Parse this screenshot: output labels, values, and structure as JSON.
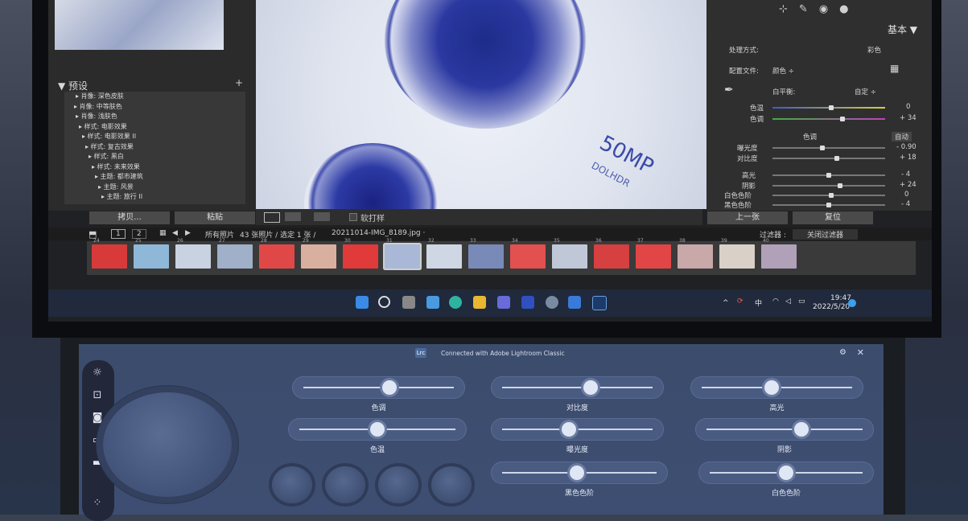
{
  "lightroom": {
    "left_panel": {
      "preset_header": "▼ 预设",
      "add_icon": "plus-icon",
      "presets": [
        "▸ 肖像: 深色皮肤",
        "▸ 肖像: 中等肤色",
        "▸ 肖像: 浅肤色",
        "▸ 样式: 电影效果",
        "▸ 样式: 电影效果 II",
        "▸ 样式: 复古效果",
        "▸ 样式: 黑白",
        "▸ 样式: 未来效果",
        "▸ 主题: 都市建筑",
        "▸ 主题: 风景",
        "▸ 主题: 旅行 II"
      ],
      "copy_button": "拷贝...",
      "paste_button": "粘贴"
    },
    "photo": {
      "mp_text": "50MP",
      "mp_sub": "DOLHDR"
    },
    "toolbar": {
      "softproof_label": "软打样"
    },
    "right_panel": {
      "title": "基本 ▼",
      "treatment_label": "处理方式:",
      "treatment_value": "彩色",
      "profile_label": "配置文件:",
      "profile_value": "颜色 ÷",
      "wb_label": "白平衡:",
      "wb_value": "自定 ÷",
      "temp_label": "色温",
      "temp_value": "0",
      "tint_label": "色调",
      "tint_value": "+ 34",
      "tone_label": "色调",
      "tone_auto": "自动",
      "exposure_label": "曝光度",
      "exposure_value": "- 0.90",
      "contrast_label": "对比度",
      "contrast_value": "+ 18",
      "highlights_label": "高光",
      "highlights_value": "- 4",
      "shadows_label": "阴影",
      "shadows_value": "+ 24",
      "whites_label": "白色色阶",
      "whites_value": "0",
      "blacks_label": "黑色色阶",
      "blacks_value": "- 4",
      "prev_button": "上一张",
      "reset_button": "复位"
    },
    "filmstrip_bar": {
      "page1": "1",
      "page2": "2",
      "source": "所有照片",
      "count": "43 张照片 / 选定 1 张 /",
      "filename": "20211014-IMG_8189.jpg ·",
      "filter_label": "过滤器 :",
      "filter_value": "关闭过滤器"
    },
    "frame_numbers": [
      "24",
      "25",
      "26",
      "27",
      "28",
      "29",
      "30",
      "31",
      "32",
      "33",
      "34",
      "35",
      "36",
      "37",
      "38",
      "39",
      "40"
    ]
  },
  "taskbar": {
    "ime": "中",
    "time": "19:47",
    "date": "2022/5/20"
  },
  "screenpad": {
    "app_badge": "Lrc",
    "title": "Connected with Adobe Lightroom Classic",
    "sliders": [
      {
        "label": "色调",
        "value": 0.58
      },
      {
        "label": "对比度",
        "value": 0.6
      },
      {
        "label": "高光",
        "value": 0.46
      },
      {
        "label": "色温",
        "value": 0.5
      },
      {
        "label": "曝光度",
        "value": 0.44
      },
      {
        "label": "阴影",
        "value": 0.62
      },
      {
        "label": "黑色色阶",
        "value": 0.48
      },
      {
        "label": "白色色阶",
        "value": 0.5
      }
    ]
  }
}
